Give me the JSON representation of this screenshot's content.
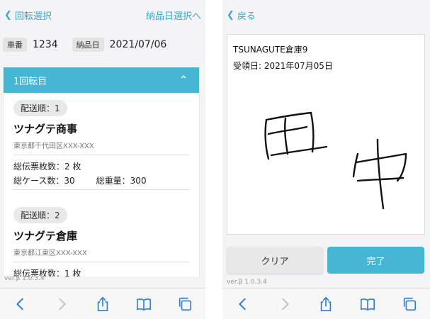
{
  "left": {
    "nav": {
      "back_label": "回転選択",
      "next_label": "納品日選択へ"
    },
    "info": {
      "vehicle_label": "車番",
      "vehicle_value": "1234",
      "date_label": "納品日",
      "date_value": "2021/07/06"
    },
    "accordion": {
      "title": "1回転目"
    },
    "deliveries": [
      {
        "order": "配送順：1",
        "name": "ツナグテ商事",
        "address": "東京都千代田区XXX-XXX",
        "slips": "総伝票枚数：2 枚",
        "cases": "総ケース数：30",
        "weight": "総重量：300"
      },
      {
        "order": "配送順：2",
        "name": "ツナグテ倉庫",
        "address": "東京都江東区XXX-XXX",
        "slips": "総伝票枚数：1 枚"
      }
    ],
    "version": "ver.β 1.0.3.4"
  },
  "right": {
    "nav": {
      "back_label": "戻る"
    },
    "warehouse": "TSUNAGUTE倉庫9",
    "received_date": "受領日: 2021年07月05日",
    "clear_label": "クリア",
    "done_label": "完了",
    "version": "ver.β 1.0.3.4"
  },
  "toolbar_icons": [
    "back-arrow-icon",
    "forward-arrow-icon",
    "share-icon",
    "bookmarks-icon",
    "tabs-icon"
  ],
  "colors": {
    "accent": "#45b6d3",
    "link": "#3aa7cc",
    "toolbar_icon": "#2f7fd6",
    "toolbar_disabled": "#b7c7d8"
  }
}
